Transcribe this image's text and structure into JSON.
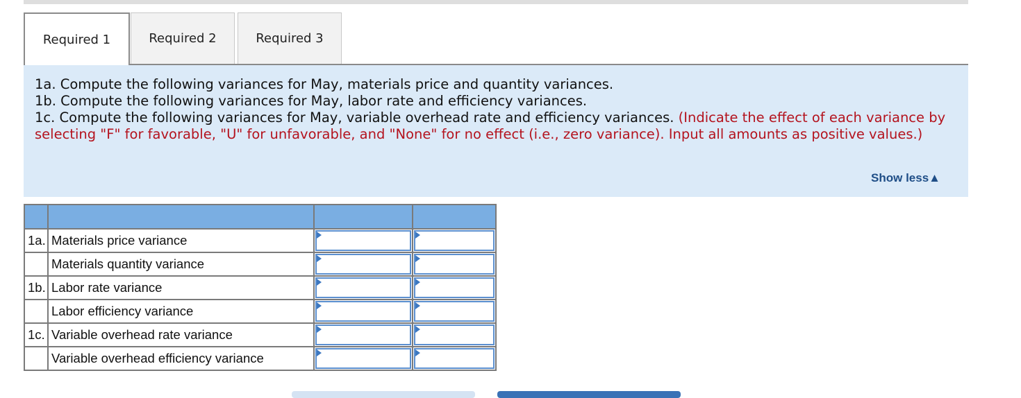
{
  "tabs": [
    {
      "label": "Required 1",
      "active": true
    },
    {
      "label": "Required 2",
      "active": false
    },
    {
      "label": "Required 3",
      "active": false
    }
  ],
  "instructions": {
    "line1": "1a. Compute the following variances for May, materials price and quantity variances.",
    "line2": "1b. Compute the following variances for May, labor rate and efficiency variances.",
    "line3": "1c. Compute the following variances for May, variable overhead rate and efficiency variances.",
    "note": "(Indicate the effect of each variance by selecting \"F\" for favorable, \"U\" for unfavorable, and \"None\" for no effect (i.e., zero variance). Input all amounts as positive values.)",
    "show_less": "Show less▲"
  },
  "table": {
    "rows": [
      {
        "num": "1a.",
        "label": "Materials price variance",
        "amount": "",
        "effect": ""
      },
      {
        "num": "",
        "label": "Materials quantity variance",
        "amount": "",
        "effect": ""
      },
      {
        "num": "1b.",
        "label": "Labor rate variance",
        "amount": "",
        "effect": ""
      },
      {
        "num": "",
        "label": "Labor efficiency variance",
        "amount": "",
        "effect": ""
      },
      {
        "num": "1c.",
        "label": "Variable overhead rate variance",
        "amount": "",
        "effect": ""
      },
      {
        "num": "",
        "label": "Variable overhead efficiency variance",
        "amount": "",
        "effect": ""
      }
    ]
  },
  "colors": {
    "header_blue": "#7aaee2",
    "panel_blue": "#dbeaf8",
    "note_red": "#b4131e",
    "link_blue": "#1f4e87"
  }
}
